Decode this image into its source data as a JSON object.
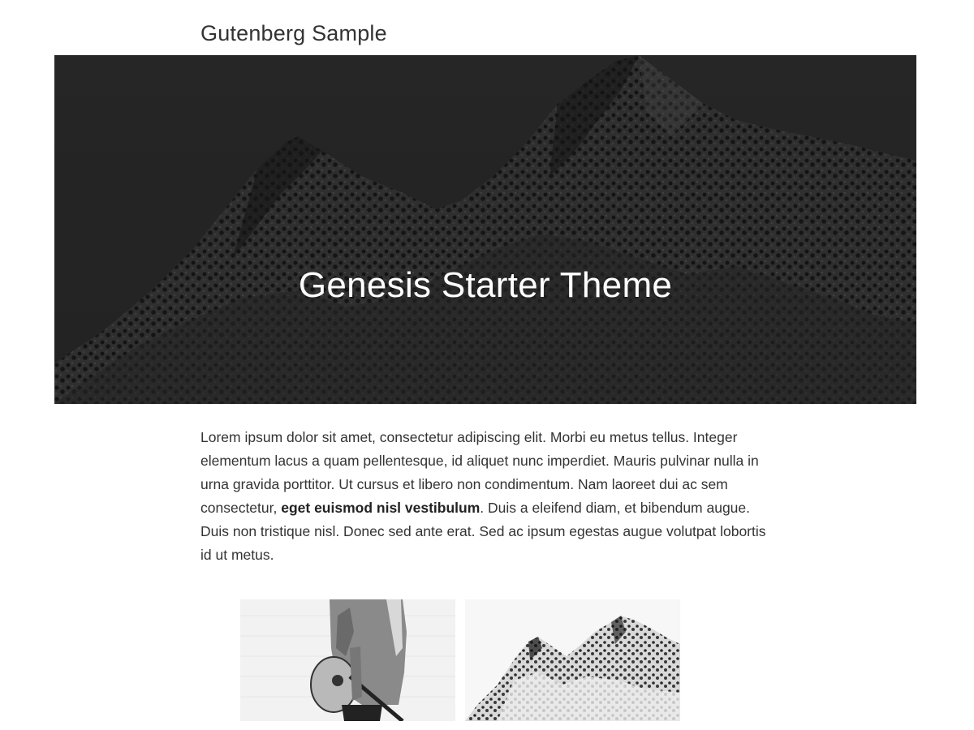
{
  "site": {
    "title": "Gutenberg Sample"
  },
  "hero": {
    "heading": "Genesis Starter Theme",
    "background_image": "mountain-photo-dark"
  },
  "content": {
    "paragraph_part1": "Lorem ipsum dolor sit amet, consectetur adipiscing elit. Morbi eu metus tellus. Integer elementum lacus a quam pellentesque, id aliquet nunc imperdiet. Mauris pulvinar nulla in urna gravida porttitor. Ut cursus et libero non condimentum. Nam laoreet dui ac sem consectetur, ",
    "paragraph_bold": "eget euismod nisl vestibulum",
    "paragraph_part2": ". Duis a eleifend diam, et bibendum augue. Duis non tristique nisl. Donec sed ante erat. Sed ac ipsum egestas augue volutpat lobortis id ut metus."
  },
  "gallery": {
    "images": [
      {
        "subject": "person-with-guitar-photo"
      },
      {
        "subject": "snowy-mountain-photo"
      }
    ]
  },
  "colors": {
    "text": "#333333",
    "hero_bg": "#1f1f1f",
    "hero_text": "#ffffff"
  }
}
